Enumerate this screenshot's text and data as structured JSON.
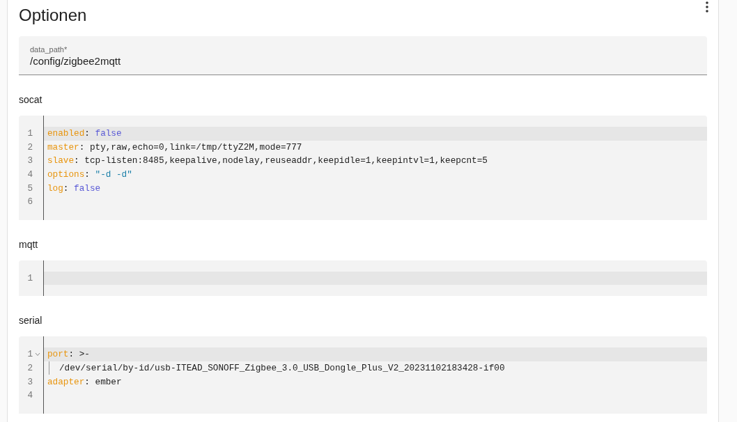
{
  "title": "Optionen",
  "field": {
    "label": "data_path*",
    "value": "/config/zigbee2mqtt"
  },
  "sections": [
    {
      "label": "socat",
      "lines": [
        {
          "number": "1",
          "active": true,
          "foldable": false,
          "indented": false,
          "tokens": [
            {
              "kind": "key",
              "text": "enabled"
            },
            {
              "kind": "plain",
              "text": ": "
            },
            {
              "kind": "bool",
              "text": "false"
            }
          ]
        },
        {
          "number": "2",
          "active": false,
          "foldable": false,
          "indented": false,
          "tokens": [
            {
              "kind": "key",
              "text": "master"
            },
            {
              "kind": "plain",
              "text": ": pty,raw,echo=0,link=/tmp/ttyZ2M,mode=777"
            }
          ]
        },
        {
          "number": "3",
          "active": false,
          "foldable": false,
          "indented": false,
          "tokens": [
            {
              "kind": "key",
              "text": "slave"
            },
            {
              "kind": "plain",
              "text": ": tcp-listen:8485,keepalive,nodelay,reuseaddr,keepidle=1,keepintvl=1,keepcnt=5"
            }
          ]
        },
        {
          "number": "4",
          "active": false,
          "foldable": false,
          "indented": false,
          "tokens": [
            {
              "kind": "key",
              "text": "options"
            },
            {
              "kind": "plain",
              "text": ": "
            },
            {
              "kind": "string",
              "text": "\"-d -d\""
            }
          ]
        },
        {
          "number": "5",
          "active": false,
          "foldable": false,
          "indented": false,
          "tokens": [
            {
              "kind": "key",
              "text": "log"
            },
            {
              "kind": "plain",
              "text": ": "
            },
            {
              "kind": "bool",
              "text": "false"
            }
          ]
        },
        {
          "number": "6",
          "active": false,
          "foldable": false,
          "indented": false
        }
      ]
    },
    {
      "label": "mqtt",
      "lines": [
        {
          "number": "1",
          "active": true,
          "foldable": false,
          "indented": false
        }
      ]
    },
    {
      "label": "serial",
      "lines": [
        {
          "number": "1",
          "active": true,
          "foldable": true,
          "indented": false,
          "tokens": [
            {
              "kind": "key",
              "text": "port"
            },
            {
              "kind": "plain",
              "text": ": >-"
            }
          ]
        },
        {
          "number": "2",
          "active": false,
          "foldable": false,
          "indented": true,
          "tokens": [
            {
              "kind": "plain",
              "text": "/dev/serial/by-id/usb-ITEAD_SONOFF_Zigbee_3.0_USB_Dongle_Plus_V2_20231102183428-if00"
            }
          ]
        },
        {
          "number": "3",
          "active": false,
          "foldable": false,
          "indented": false,
          "tokens": [
            {
              "kind": "key",
              "text": "adapter"
            },
            {
              "kind": "plain",
              "text": ": ember"
            }
          ]
        },
        {
          "number": "4",
          "active": false,
          "foldable": false,
          "indented": false
        }
      ]
    }
  ]
}
